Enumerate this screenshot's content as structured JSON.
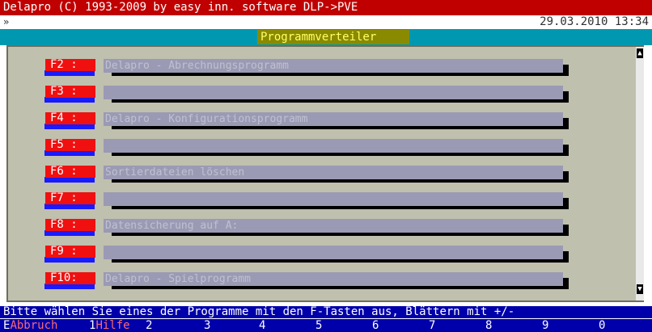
{
  "title_bar": {
    "text": "Delapro (C) 1993-2009 by easy inn. software  DLP->PVE"
  },
  "prompt": {
    "symbol": "»",
    "datetime": "29.03.2010 13:34"
  },
  "header": {
    "title": "Programmverteiler"
  },
  "menu": {
    "items": [
      {
        "key": "F2 :",
        "label": "Delapro - Abrechnungsprogramm"
      },
      {
        "key": "F3 :",
        "label": ""
      },
      {
        "key": "F4 :",
        "label": "Delapro - Konfigurationsprogramm"
      },
      {
        "key": "F5 :",
        "label": ""
      },
      {
        "key": "F6 :",
        "label": "Sortierdateien löschen"
      },
      {
        "key": "F7 :",
        "label": ""
      },
      {
        "key": "F8 :",
        "label": "Datensicherung auf A:"
      },
      {
        "key": "F9 :",
        "label": ""
      },
      {
        "key": "F10:",
        "label": "Delapro - Spielprogramm"
      }
    ]
  },
  "scrollbar": {
    "up_icon": "scroll-up-arrow",
    "down_icon": "scroll-down-arrow"
  },
  "status": {
    "text": "Bitte wählen Sie eines der Programme mit den F-Tasten aus, Blättern mit +/-"
  },
  "fkeys": [
    {
      "num": "E",
      "label": "Abbruch"
    },
    {
      "num": "1",
      "label": "Hilfe"
    },
    {
      "num": "2",
      "label": ""
    },
    {
      "num": "3",
      "label": ""
    },
    {
      "num": "4",
      "label": ""
    },
    {
      "num": "5",
      "label": ""
    },
    {
      "num": "6",
      "label": ""
    },
    {
      "num": "7",
      "label": ""
    },
    {
      "num": "8",
      "label": ""
    },
    {
      "num": "9",
      "label": ""
    },
    {
      "num": "0",
      "label": ""
    }
  ],
  "colors": {
    "title_bg": "#c00000",
    "header_bg": "#0098b0",
    "header_box": "#8a8a00",
    "panel_bg": "#c0c0ae",
    "fkey_bg": "#f01010",
    "bar_bg": "#9a9ab4",
    "status_bg": "#0000aa"
  }
}
